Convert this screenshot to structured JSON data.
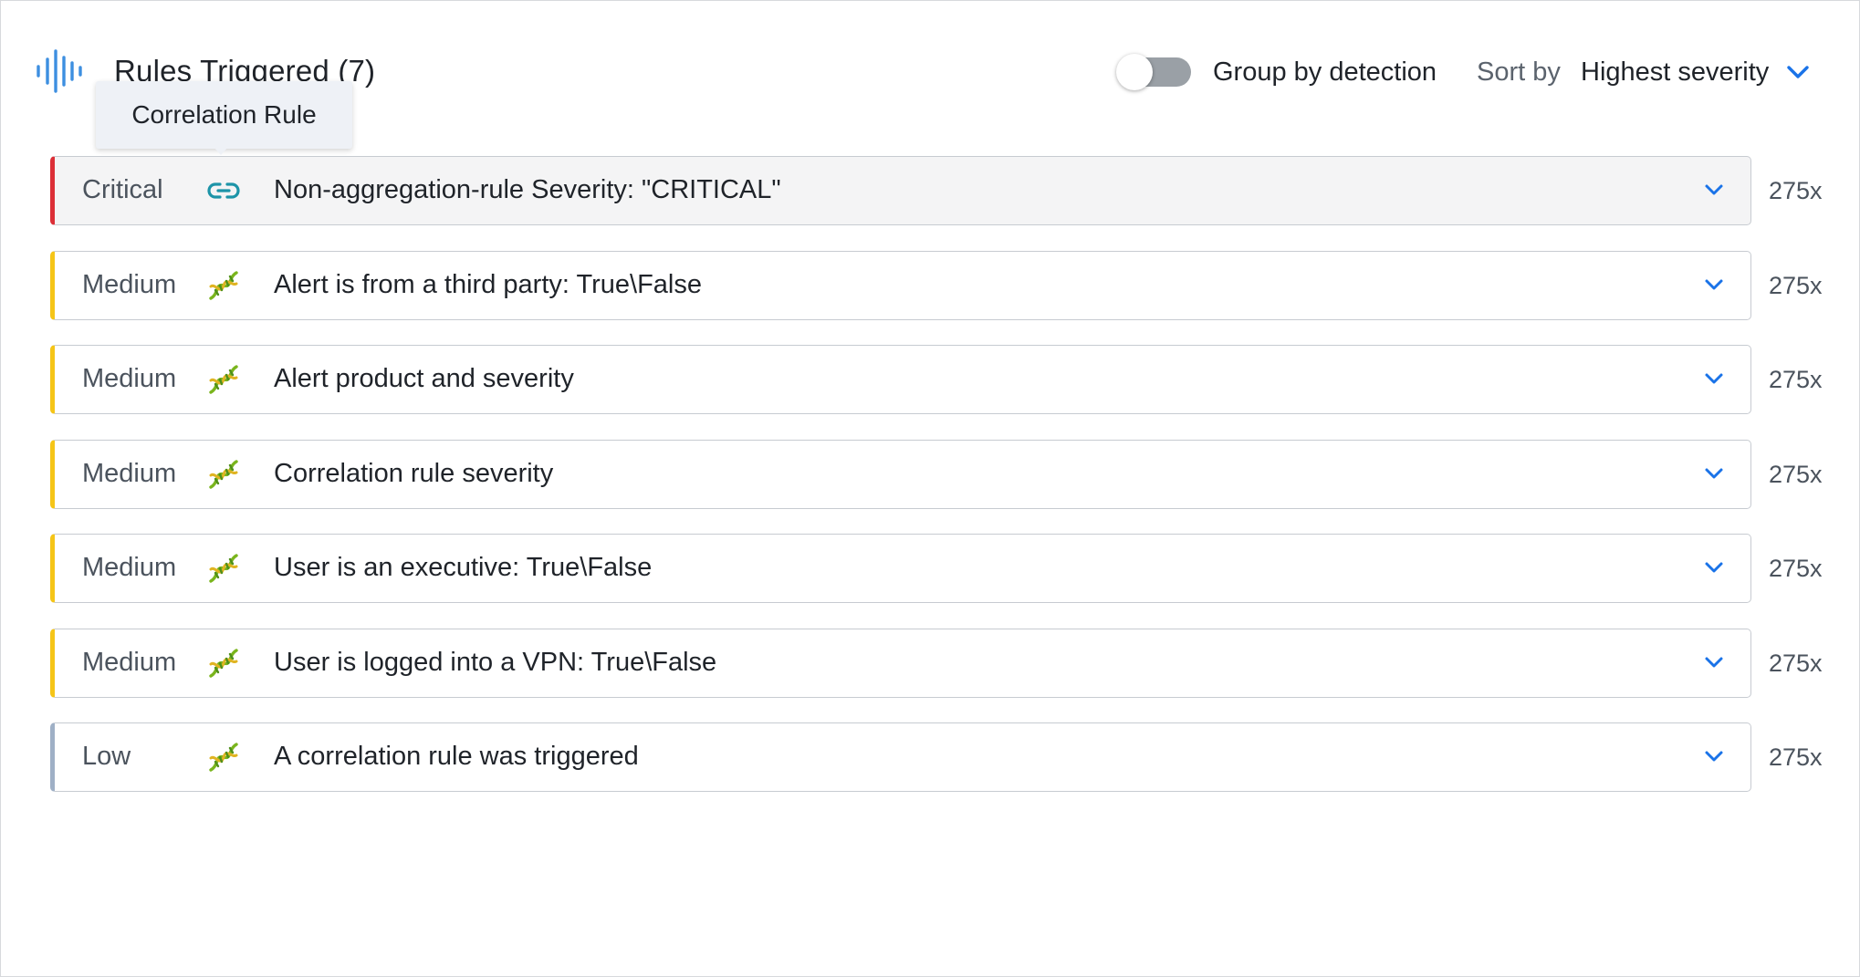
{
  "header": {
    "title": "Rules Triggered (7)",
    "brand_icon": "waveform-icon",
    "group_toggle": {
      "label": "Group by detection",
      "on": false
    },
    "sort": {
      "label": "Sort by",
      "value": "Highest severity"
    }
  },
  "tooltip": {
    "text": "Correlation Rule"
  },
  "colors": {
    "critical": "#dc2f37",
    "medium": "#f5c518",
    "low": "#9fb0c6",
    "accent": "#1a73e8",
    "link_icon": "#1d94a8"
  },
  "rules": [
    {
      "severity": "Critical",
      "icon": "link-icon",
      "name": "Non-aggregation-rule Severity: \"CRITICAL\"",
      "count": "275x"
    },
    {
      "severity": "Medium",
      "icon": "dna-icon",
      "name": "Alert is from a third party: True\\False",
      "count": "275x"
    },
    {
      "severity": "Medium",
      "icon": "dna-icon",
      "name": "Alert product and severity",
      "count": "275x"
    },
    {
      "severity": "Medium",
      "icon": "dna-icon",
      "name": "Correlation rule severity",
      "count": "275x"
    },
    {
      "severity": "Medium",
      "icon": "dna-icon",
      "name": "User is an executive: True\\False",
      "count": "275x"
    },
    {
      "severity": "Medium",
      "icon": "dna-icon",
      "name": "User is logged into a VPN: True\\False",
      "count": "275x"
    },
    {
      "severity": "Low",
      "icon": "dna-icon",
      "name": "A correlation rule was triggered",
      "count": "275x"
    }
  ]
}
